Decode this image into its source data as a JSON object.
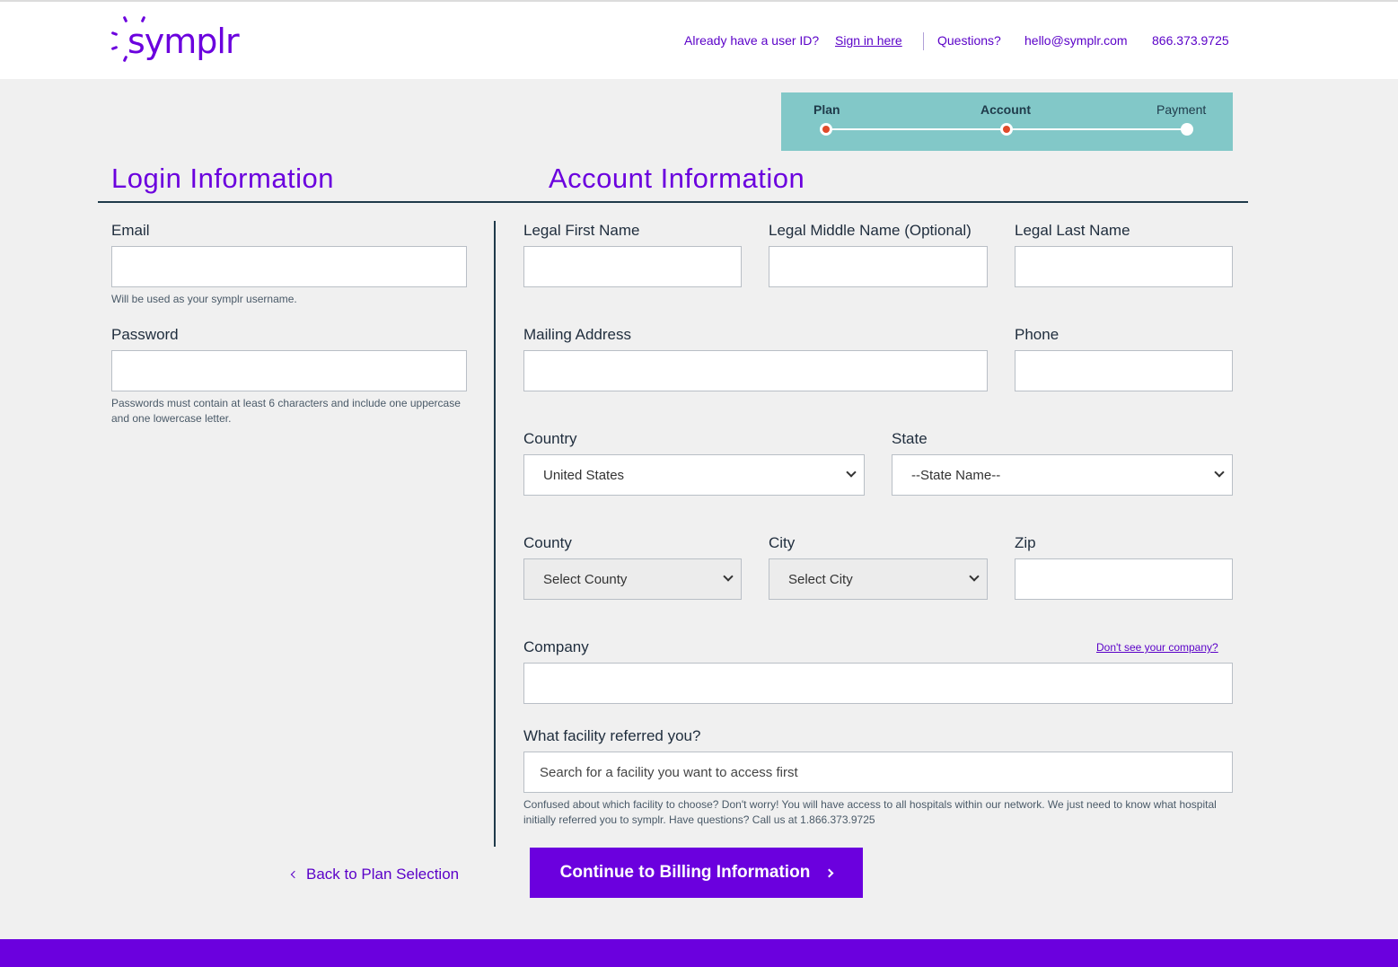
{
  "brand": {
    "logo_text": "symplr",
    "accent": "#6b00de"
  },
  "topnav": {
    "have_id": "Already have a user ID?",
    "sign_in": "Sign in here",
    "questions": "Questions?",
    "email": "hello@symplr.com",
    "phone": "866.373.9725"
  },
  "stepper": {
    "steps": [
      "Plan",
      "Account",
      "Payment"
    ],
    "completed": [
      "Plan",
      "Account"
    ]
  },
  "login": {
    "title": "Login Information",
    "email_label": "Email",
    "email_value": "",
    "email_help": "Will be used as your symplr username.",
    "password_label": "Password",
    "password_value": "",
    "password_help": "Passwords must contain at least 6 characters and include one uppercase and one lowercase letter."
  },
  "account": {
    "title": "Account Information",
    "first_name_label": "Legal First Name",
    "middle_name_label": "Legal Middle Name (Optional)",
    "last_name_label": "Legal Last Name",
    "address_label": "Mailing Address",
    "phone_label": "Phone",
    "country_label": "Country",
    "country_value": "United States",
    "state_label": "State",
    "state_value": "--State Name--",
    "county_label": "County",
    "county_value": "Select County",
    "city_label": "City",
    "city_value": "Select City",
    "zip_label": "Zip",
    "company_label": "Company",
    "company_link": "Don't see your company?",
    "facility_label": "What facility referred you?",
    "facility_placeholder": "Search for a facility you want to access first",
    "facility_help": "Confused about which facility to choose? Don't worry! You will have access to all hospitals within our network. We just need to know what hospital initially referred you to symplr. Have questions? Call us at 1.866.373.9725"
  },
  "actions": {
    "back": "Back to Plan Selection",
    "continue": "Continue to Billing Information"
  }
}
